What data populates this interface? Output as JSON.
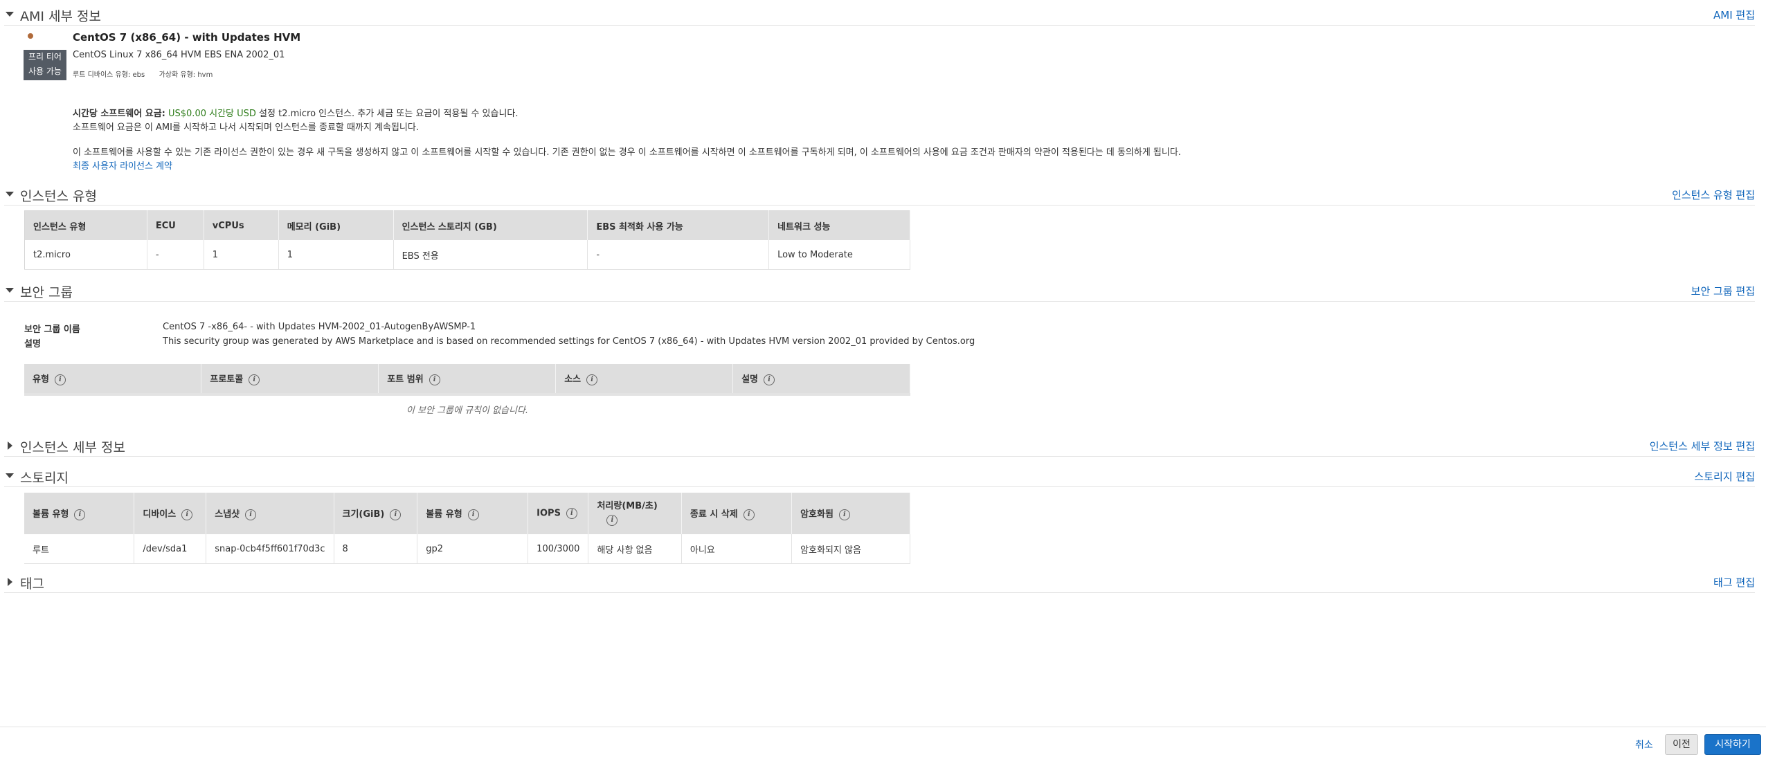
{
  "ami": {
    "title": "AMI 세부 정보",
    "edit": "AMI 편집",
    "badge_line1": "프리 티어",
    "badge_line2": "사용 가능",
    "name": "CentOS 7 (x86_64) - with Updates HVM",
    "description": "CentOS Linux 7 x86_64 HVM EBS ENA 2002_01",
    "root_device": "루트 디바이스 유형: ebs",
    "virtualization": "가상화 유형: hvm",
    "price_label": "시간당 소프트웨어 요금:",
    "price_value": "US$0.00 시간당 USD",
    "price_suffix": "설정 t2.micro 인스턴스. 추가 세금 또는 요금이 적용될 수 있습니다.",
    "price_note": "소프트웨어 요금은 이 AMI를 시작하고 나서 시작되며 인스턴스를 종료할 때까지 계속됩니다.",
    "license_text": "이 소프트웨어를 사용할 수 있는 기존 라이선스 권한이 있는 경우 새 구독을 생성하지 않고 이 소프트웨어를 시작할 수 있습니다. 기존 권한이 없는 경우 이 소프트웨어를 시작하면 이 소프트웨어를 구독하게 되며, 이 소프트웨어의 사용에 요금 조건과 판매자의 약관이 적용된다는 데 동의하게 됩니다.",
    "eula_link": "최종 사용자 라이선스 계약"
  },
  "instance_type": {
    "title": "인스턴스 유형",
    "edit": "인스턴스 유형 편집",
    "headers": [
      "인스턴스 유형",
      "ECU",
      "vCPUs",
      "메모리 (GiB)",
      "인스턴스 스토리지 (GB)",
      "EBS 최적화 사용 가능",
      "네트워크 성능"
    ],
    "row": [
      "t2.micro",
      "-",
      "1",
      "1",
      "EBS 전용",
      "-",
      "Low to Moderate"
    ]
  },
  "security_group": {
    "title": "보안 그룹",
    "edit": "보안 그룹 편집",
    "name_label": "보안 그룹 이름",
    "name_value": "CentOS 7 -x86_64- - with Updates HVM-2002_01-AutogenByAWSMP-1",
    "desc_label": "설명",
    "desc_value": "This security group was generated by AWS Marketplace and is based on recommended settings for CentOS 7 (x86_64) - with Updates HVM version 2002_01 provided by Centos.org",
    "headers": [
      "유형",
      "프로토콜",
      "포트 범위",
      "소스",
      "설명"
    ],
    "empty": "이 보안 그룹에 규칙이 없습니다."
  },
  "instance_details": {
    "title": "인스턴스 세부 정보",
    "edit": "인스턴스 세부 정보 편집"
  },
  "storage": {
    "title": "스토리지",
    "edit": "스토리지 편집",
    "headers": [
      "볼륨 유형",
      "디바이스",
      "스냅샷",
      "크기(GiB)",
      "볼륨 유형",
      "IOPS",
      "처리량(MB/초)",
      "종료 시 삭제",
      "암호화됨"
    ],
    "row": [
      "루트",
      "/dev/sda1",
      "snap-0cb4f5ff601f70d3c",
      "8",
      "gp2",
      "100/3000",
      "해당 사항 없음",
      "아니요",
      "암호화되지 않음"
    ]
  },
  "tags": {
    "title": "태그",
    "edit": "태그 편집"
  },
  "footer": {
    "cancel": "취소",
    "previous": "이전",
    "launch": "시작하기"
  },
  "colors": {
    "link": "#1166bb",
    "primary_button": "#1a73c9",
    "header_bg": "#dedede",
    "price_green": "#2f7d1b"
  }
}
